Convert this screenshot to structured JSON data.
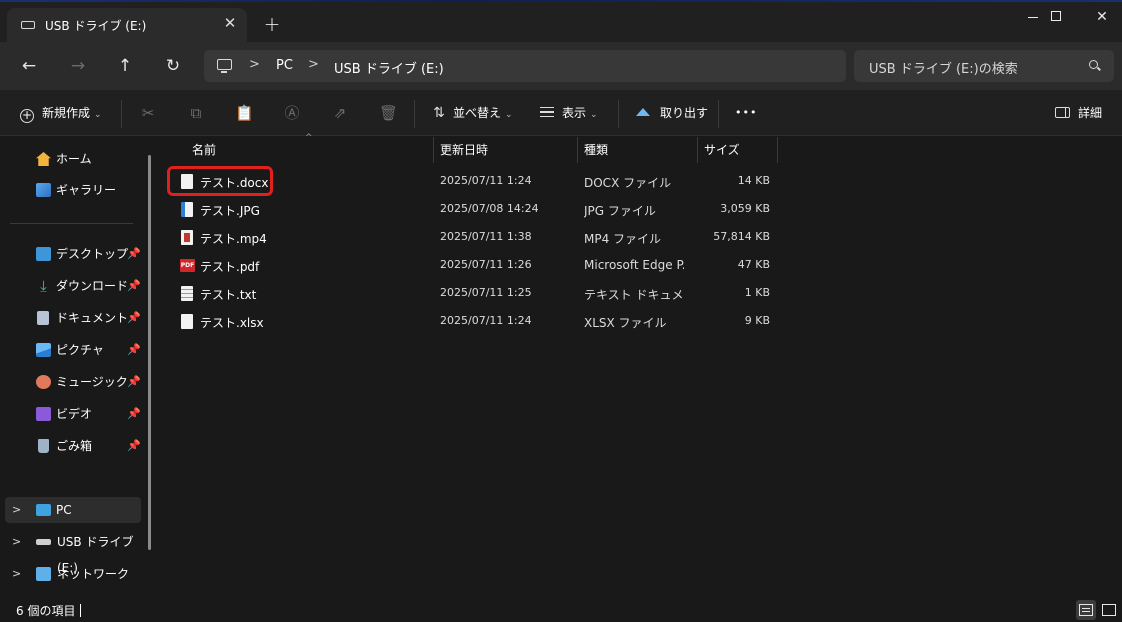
{
  "window": {
    "tab_title": "USB ドライブ (E:)",
    "tab_close": "✕",
    "new_tab": "+",
    "minimize": "—",
    "maximize": "☐",
    "close": "✕"
  },
  "address": {
    "back": "←",
    "forward": "→",
    "up": "↑",
    "refresh": "↻",
    "breadcrumbs": [
      "PC",
      "USB ドライブ (E:)"
    ],
    "separator": ">",
    "search_placeholder": "USB ドライブ (E:)の検索"
  },
  "commands": {
    "new_label": "新規作成",
    "sort_label": "並べ替え",
    "view_label": "表示",
    "eject_label": "取り出す",
    "more_label": "•••",
    "details_label": "詳細",
    "chevron": "⌄"
  },
  "sidebar": {
    "items": [
      {
        "label": "ホーム",
        "icon": "home-icon"
      },
      {
        "label": "ギャラリー",
        "icon": "gallery-icon"
      },
      {
        "label": "デスクトップ",
        "icon": "desktop-icon",
        "pinned": true
      },
      {
        "label": "ダウンロード",
        "icon": "download-icon",
        "pinned": true
      },
      {
        "label": "ドキュメント",
        "icon": "documents-icon",
        "pinned": true
      },
      {
        "label": "ピクチャ",
        "icon": "pictures-icon",
        "pinned": true
      },
      {
        "label": "ミュージック",
        "icon": "music-icon",
        "pinned": true
      },
      {
        "label": "ビデオ",
        "icon": "video-icon",
        "pinned": true
      },
      {
        "label": "ごみ箱",
        "icon": "recycle-bin-icon",
        "pinned": true
      },
      {
        "label": "PC",
        "icon": "pc-icon"
      },
      {
        "label": "USB ドライブ (E:)",
        "icon": "usb-drive-icon"
      },
      {
        "label": "ネットワーク",
        "icon": "network-icon"
      }
    ],
    "pin_glyph": "📌",
    "expand_glyph": ">"
  },
  "files": {
    "columns": [
      "名前",
      "更新日時",
      "種類",
      "サイズ"
    ],
    "sort_glyph": "^",
    "rows": [
      {
        "name": "テスト.docx",
        "date": "2025/07/11 1:24",
        "type": "DOCX ファイル",
        "size": "14 KB",
        "icon": "docx-file-icon"
      },
      {
        "name": "テスト.JPG",
        "date": "2025/07/08 14:24",
        "type": "JPG ファイル",
        "size": "3,059 KB",
        "icon": "jpg-file-icon"
      },
      {
        "name": "テスト.mp4",
        "date": "2025/07/11 1:38",
        "type": "MP4 ファイル",
        "size": "57,814 KB",
        "icon": "mp4-file-icon"
      },
      {
        "name": "テスト.pdf",
        "date": "2025/07/11 1:26",
        "type": "Microsoft Edge P...",
        "size": "47 KB",
        "icon": "pdf-file-icon"
      },
      {
        "name": "テスト.txt",
        "date": "2025/07/11 1:25",
        "type": "テキスト ドキュメント",
        "size": "1 KB",
        "icon": "txt-file-icon"
      },
      {
        "name": "テスト.xlsx",
        "date": "2025/07/11 1:24",
        "type": "XLSX ファイル",
        "size": "9 KB",
        "icon": "xlsx-file-icon"
      }
    ],
    "pdf_badge": "PDF"
  },
  "status": {
    "item_count": "6 個の項目"
  },
  "colors": {
    "highlight": "#e0201c",
    "accent": "#6fb7f2"
  }
}
